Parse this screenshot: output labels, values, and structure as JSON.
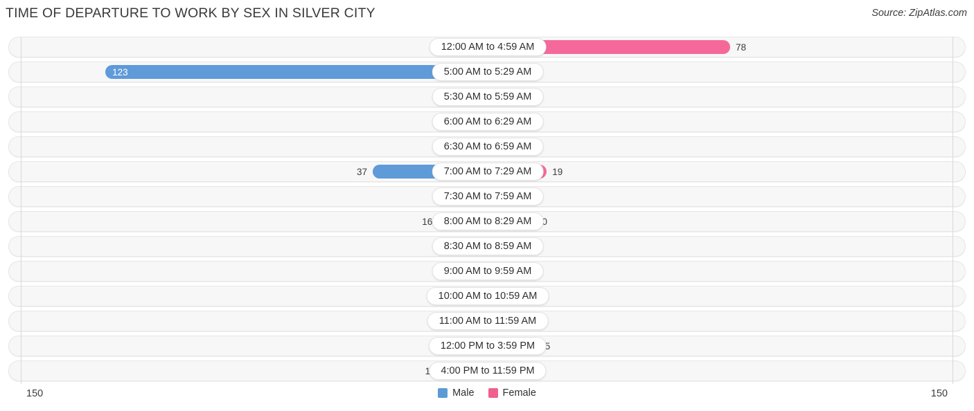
{
  "header": {
    "title": "TIME OF DEPARTURE TO WORK BY SEX IN SILVER CITY",
    "source": "Source: ZipAtlas.com"
  },
  "axis": {
    "left_max_label": "150",
    "right_max_label": "150"
  },
  "legend": {
    "items": [
      {
        "label": "Male",
        "color": "#5b9bd5"
      },
      {
        "label": "Female",
        "color": "#f0608f"
      }
    ]
  },
  "colors": {
    "male_strong": "#5f9ad9",
    "male_light": "#aecbec",
    "female_strong": "#f4699a",
    "female_light": "#f9a8c4",
    "row_track": "#f7f7f7",
    "row_border": "#e6e6e6",
    "gridline": "#d8d8d8",
    "title_text": "#3a3a3a"
  },
  "chart_data": {
    "type": "bar",
    "title": "TIME OF DEPARTURE TO WORK BY SEX IN SILVER CITY",
    "subtitle": "",
    "orientation": "horizontal-diverging",
    "xlabel": "",
    "ylabel": "",
    "xlim": [
      150,
      150
    ],
    "grid": true,
    "legend_position": "bottom-center",
    "categories": [
      "12:00 AM to 4:59 AM",
      "5:00 AM to 5:29 AM",
      "5:30 AM to 5:59 AM",
      "6:00 AM to 6:29 AM",
      "6:30 AM to 6:59 AM",
      "7:00 AM to 7:29 AM",
      "7:30 AM to 7:59 AM",
      "8:00 AM to 8:29 AM",
      "8:30 AM to 8:59 AM",
      "9:00 AM to 9:59 AM",
      "10:00 AM to 10:59 AM",
      "11:00 AM to 11:59 AM",
      "12:00 PM to 3:59 PM",
      "4:00 PM to 11:59 PM"
    ],
    "series": [
      {
        "name": "Male",
        "color": "#5b9bd5",
        "values": [
          0,
          123,
          0,
          0,
          0,
          37,
          0,
          16,
          0,
          0,
          0,
          0,
          0,
          15
        ],
        "labels": [
          "0",
          "123",
          "0",
          "0",
          "0",
          "37",
          "0",
          "16",
          "0",
          "0",
          "0",
          "0",
          "0",
          "15"
        ]
      },
      {
        "name": "Female",
        "color": "#f0608f",
        "values": [
          78,
          0,
          0,
          0,
          0,
          19,
          0,
          10,
          0,
          0,
          0,
          0,
          15,
          0
        ],
        "labels": [
          "78",
          "0",
          "0",
          "0",
          "0",
          "19",
          "0",
          "10",
          "0",
          "0",
          "0",
          "0",
          "15",
          "0"
        ]
      }
    ]
  }
}
